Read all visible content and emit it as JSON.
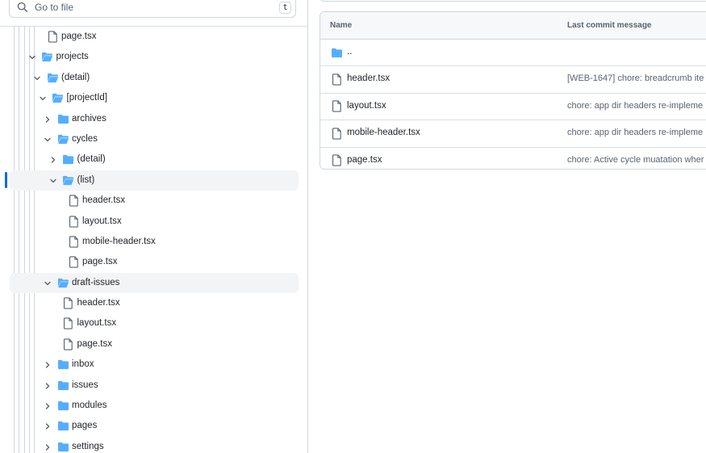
{
  "search": {
    "placeholder": "Go to file",
    "shortcut": "t"
  },
  "tree": [
    {
      "label": "page.tsx",
      "kind": "file",
      "level": 6,
      "expanded": null
    },
    {
      "label": "projects",
      "kind": "folder",
      "level": 5,
      "expanded": true
    },
    {
      "label": "(detail)",
      "kind": "folder",
      "level": 6,
      "expanded": true
    },
    {
      "label": "[projectId]",
      "kind": "folder",
      "level": 7,
      "expanded": true
    },
    {
      "label": "archives",
      "kind": "folder",
      "level": 8,
      "expanded": false
    },
    {
      "label": "cycles",
      "kind": "folder",
      "level": 8,
      "expanded": true
    },
    {
      "label": "(detail)",
      "kind": "folder",
      "level": 9,
      "expanded": false
    },
    {
      "label": "(list)",
      "kind": "folder",
      "level": 9,
      "expanded": true,
      "selected": true
    },
    {
      "label": "header.tsx",
      "kind": "file",
      "level": 10,
      "expanded": null
    },
    {
      "label": "layout.tsx",
      "kind": "file",
      "level": 10,
      "expanded": null
    },
    {
      "label": "mobile-header.tsx",
      "kind": "file",
      "level": 10,
      "expanded": null
    },
    {
      "label": "page.tsx",
      "kind": "file",
      "level": 10,
      "expanded": null
    },
    {
      "label": "draft-issues",
      "kind": "folder",
      "level": 8,
      "expanded": true,
      "hovered": true
    },
    {
      "label": "header.tsx",
      "kind": "file",
      "level": 9,
      "expanded": null
    },
    {
      "label": "layout.tsx",
      "kind": "file",
      "level": 9,
      "expanded": null
    },
    {
      "label": "page.tsx",
      "kind": "file",
      "level": 9,
      "expanded": null
    },
    {
      "label": "inbox",
      "kind": "folder",
      "level": 8,
      "expanded": false
    },
    {
      "label": "issues",
      "kind": "folder",
      "level": 8,
      "expanded": false
    },
    {
      "label": "modules",
      "kind": "folder",
      "level": 8,
      "expanded": false
    },
    {
      "label": "pages",
      "kind": "folder",
      "level": 8,
      "expanded": false
    },
    {
      "label": "settings",
      "kind": "folder",
      "level": 8,
      "expanded": false
    }
  ],
  "table": {
    "header_name": "Name",
    "header_message": "Last commit message",
    "rows": [
      {
        "name": "..",
        "kind": "folder",
        "message": ""
      },
      {
        "name": "header.tsx",
        "kind": "file",
        "message": "[WEB-1647] chore: breadcrumb ite"
      },
      {
        "name": "layout.tsx",
        "kind": "file",
        "message": "chore: app dir headers re-impleme"
      },
      {
        "name": "mobile-header.tsx",
        "kind": "file",
        "message": "chore: app dir headers re-impleme"
      },
      {
        "name": "page.tsx",
        "kind": "file",
        "message": "chore: Active cycle muatation wher"
      }
    ]
  },
  "icons": {
    "search": "search-icon",
    "folder": "folder-icon",
    "file": "file-icon",
    "chevron_down": "chevron-down-icon",
    "chevron_right": "chevron-right-icon"
  },
  "colors": {
    "folder": "#54aeff",
    "accent": "#0969da",
    "border": "#d0d7de",
    "muted_text": "#59636e"
  }
}
